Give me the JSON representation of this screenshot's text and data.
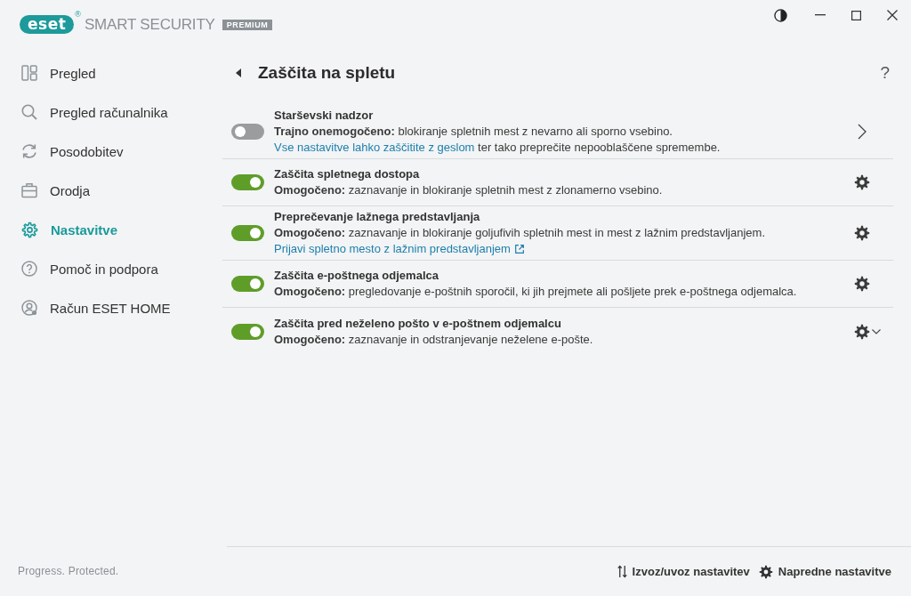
{
  "app": {
    "logo": "eset",
    "logo_mark": "®",
    "product": "SMART SECURITY",
    "edition": "PREMIUM"
  },
  "sidebar": {
    "items": [
      {
        "label": "Pregled",
        "selected": false
      },
      {
        "label": "Pregled računalnika",
        "selected": false
      },
      {
        "label": "Posodobitev",
        "selected": false
      },
      {
        "label": "Orodja",
        "selected": false
      },
      {
        "label": "Nastavitve",
        "selected": true
      },
      {
        "label": "Pomoč in podpora",
        "selected": false
      },
      {
        "label": "Račun ESET HOME",
        "selected": false
      }
    ]
  },
  "main": {
    "title": "Zaščita na spletu",
    "help": "?",
    "rows": [
      {
        "kind": "submenu",
        "title": "Starševski nadzor",
        "on": false,
        "description": "**Trajno onemogočeno:** blokiranje spletnih mest z nevarno ali sporno vsebino.",
        "note": {
          "link": "Vse nastavitve lahko zaščitite z geslom",
          "text": "ter tako preprečite nepooblaščene spremembe."
        }
      },
      {
        "kind": "settings",
        "title": "Zaščita spletnega dostopa",
        "on": true,
        "description": "**Omogočeno:** zaznavanje in blokiranje spletnih mest z zlonamerno vsebino."
      },
      {
        "kind": "settings",
        "title": "Preprečevanje lažnega predstavljanja",
        "on": true,
        "description": "**Omogočeno:** zaznavanje in blokiranje goljufivih spletnih mest in mest z lažnim predstavljanjem.",
        "link": "Prijavi spletno mesto z lažnim predstavljanjem"
      },
      {
        "kind": "settings",
        "title": "Zaščita e-poštnega odjemalca",
        "on": true,
        "description": "**Omogočeno:** pregledovanje e-poštnih sporočil, ki jih prejmete ali pošljete prek e-poštnega odjemalca."
      },
      {
        "kind": "settings-menu",
        "title": "Zaščita pred neželeno pošto v e-poštnem odjemalcu",
        "on": true,
        "description": "**Omogočeno:** zaznavanje in odstranjevanje neželene e-pošte."
      }
    ]
  },
  "footer": {
    "tagline": "Progress. Protected.",
    "buttons": [
      {
        "kind": "import-export",
        "label": "Izvoz/uvoz nastavitev"
      },
      {
        "kind": "advanced",
        "label": "Napredne nastavitve"
      }
    ]
  }
}
